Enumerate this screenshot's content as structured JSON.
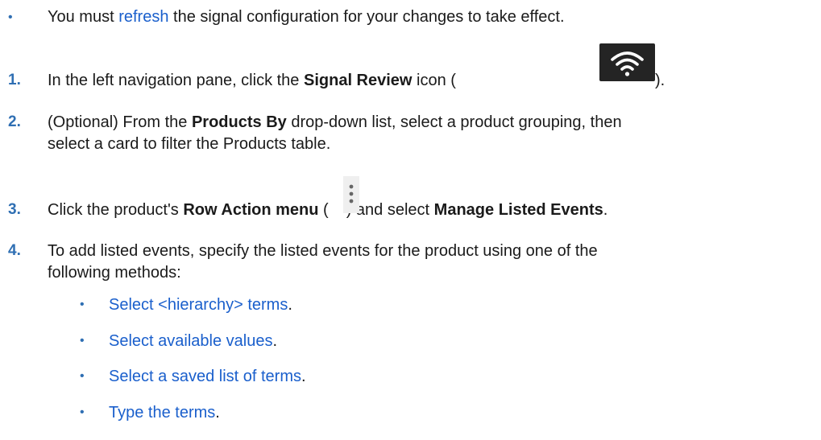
{
  "note": {
    "before": "You must ",
    "link": "refresh",
    "after": " the signal configuration for your changes to take effect."
  },
  "steps": [
    {
      "number": "1.",
      "before": "In the left navigation pane, click the ",
      "bold": "Signal Review",
      "after": " icon (",
      "close": ").",
      "icon": "wifi-icon"
    },
    {
      "number": "2.",
      "line1_before": "(Optional) From the ",
      "line1_bold": "Products By",
      "line1_after": " drop-down list, select a product grouping, then",
      "line2": "select a card to filter the Products table."
    },
    {
      "number": "3.",
      "before": "Click the product's ",
      "bold1": "Row Action menu",
      "mid_open": " (",
      "mid_close": ") and select ",
      "bold2": "Manage Listed Events",
      "end": ".",
      "icon": "kebab-menu-icon"
    },
    {
      "number": "4.",
      "line1": "To add listed events, specify the listed events for the product using one of the",
      "line2": "following methods:",
      "methods": [
        {
          "link": "Select <hierarchy> terms",
          "end": "."
        },
        {
          "link": "Select available values",
          "end": "."
        },
        {
          "link": "Select a saved list of terms",
          "end": "."
        },
        {
          "link": "Type the terms",
          "end": "."
        }
      ]
    }
  ],
  "colors": {
    "link": "#1a5fcc",
    "number": "#2f6fb3",
    "text": "#1a1a1a"
  }
}
